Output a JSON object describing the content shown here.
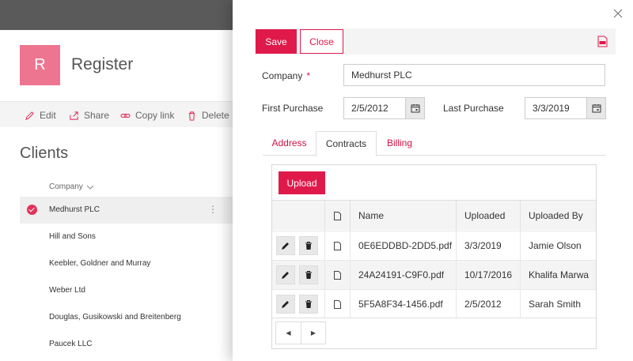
{
  "site": {
    "logo_letter": "R",
    "title": "Register"
  },
  "commands": [
    {
      "label": "Edit",
      "icon": "pencil-icon"
    },
    {
      "label": "Share",
      "icon": "share-icon"
    },
    {
      "label": "Copy link",
      "icon": "link-icon"
    },
    {
      "label": "Delete",
      "icon": "trash-icon"
    }
  ],
  "list": {
    "title": "Clients",
    "column_header": "Company",
    "rows": [
      "Medhurst PLC",
      "Hill and Sons",
      "Keebler, Goldner and Murray",
      "Weber Ltd",
      "Douglas, Gusikowski and Breitenberg",
      "Paucek LLC"
    ],
    "selected_index": 0,
    "more_glyph": "⋮"
  },
  "panel": {
    "save_label": "Save",
    "close_label": "Close",
    "company_label": "Company",
    "required_mark": "*",
    "company_value": "Medhurst PLC",
    "first_purchase_label": "First Purchase",
    "first_purchase_value": "2/5/2012",
    "last_purchase_label": "Last Purchase",
    "last_purchase_value": "3/3/2019",
    "tabs": [
      "Address",
      "Contracts",
      "Billing"
    ],
    "active_tab": "Contracts"
  },
  "grid": {
    "upload_label": "Upload",
    "columns": [
      "Name",
      "Uploaded",
      "Uploaded By"
    ],
    "rows": [
      {
        "name": "0E6EDDBD-2DD5.pdf",
        "uploaded": "3/3/2019",
        "by": "Jamie Olson"
      },
      {
        "name": "24A24191-C9F0.pdf",
        "uploaded": "10/17/2016",
        "by": "Khalifa Marwa"
      },
      {
        "name": "5F5A8F34-1456.pdf",
        "uploaded": "2/5/2012",
        "by": "Sarah Smith"
      }
    ],
    "pager_prev": "◀",
    "pager_next": "▶"
  },
  "colors": {
    "accent": "#e0194b",
    "logo": "#ee7590"
  }
}
